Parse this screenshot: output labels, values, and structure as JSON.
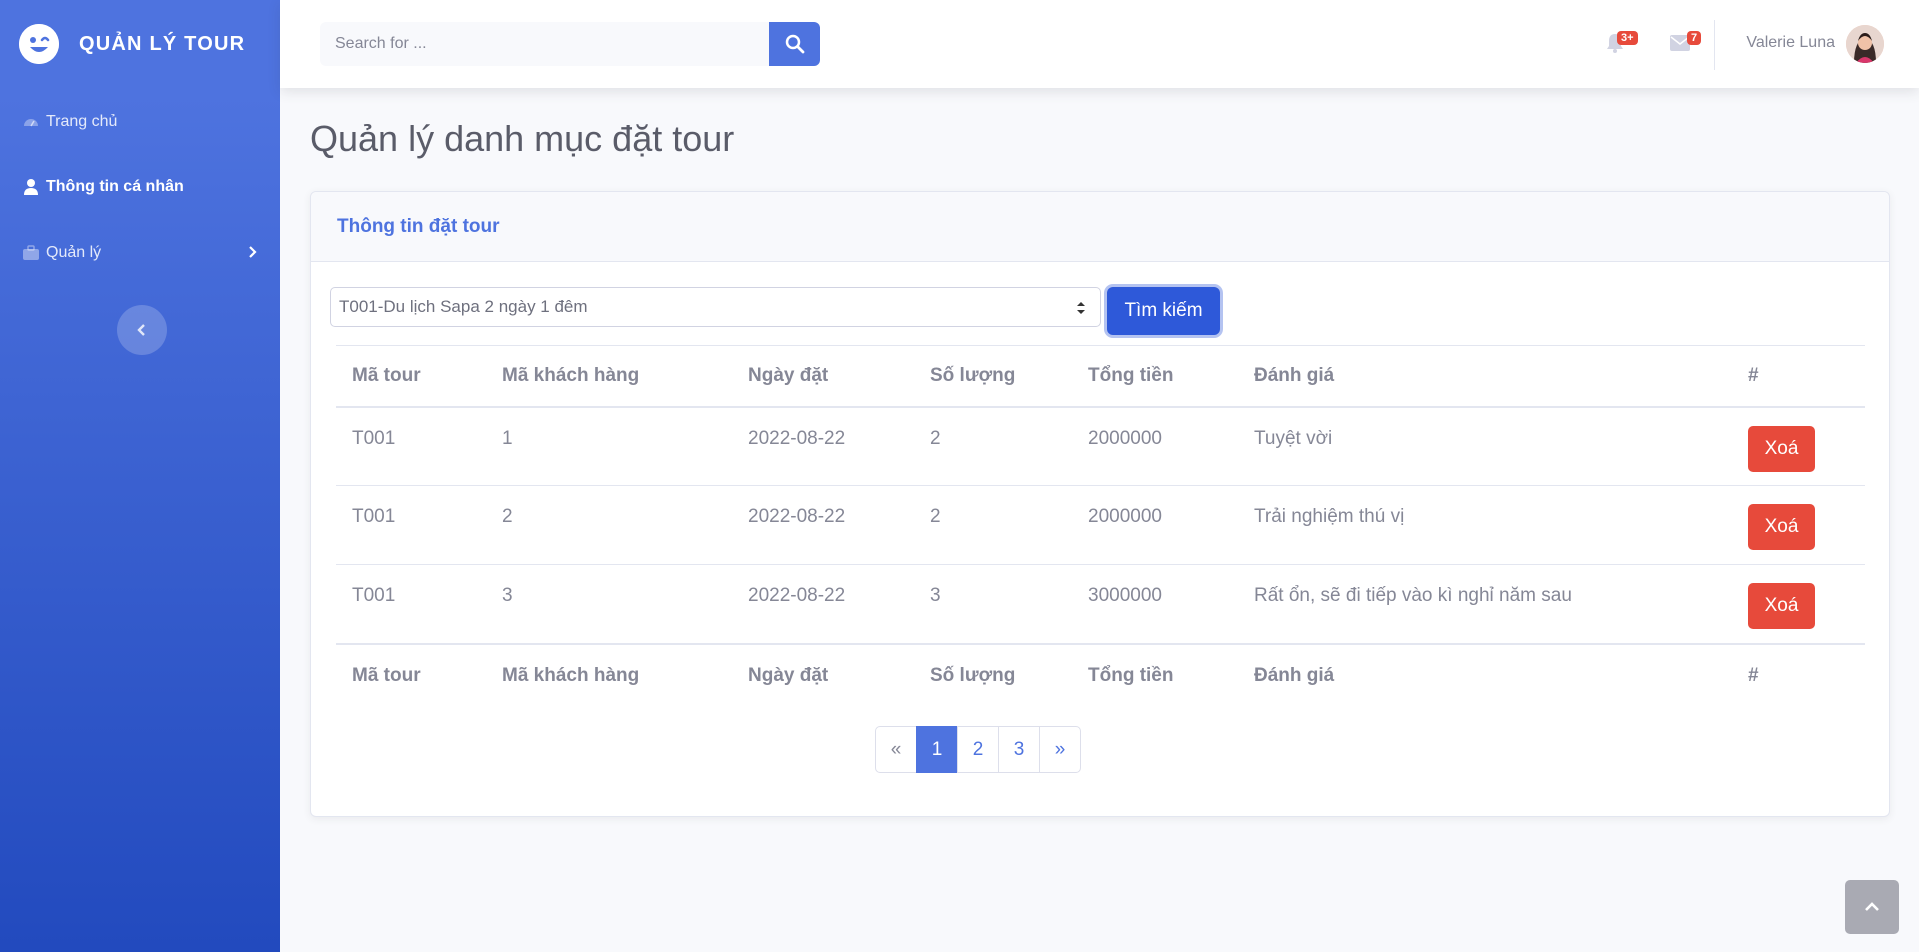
{
  "brand": {
    "name": "QUẢN LÝ TOUR",
    "icon": "laugh-wink-icon"
  },
  "sidebar": {
    "items": [
      {
        "label": "Trang chủ",
        "icon": "tachometer-icon"
      },
      {
        "label": "Thông tin cá nhân",
        "icon": "user-icon"
      },
      {
        "label": "Quản lý",
        "icon": "briefcase-icon"
      }
    ]
  },
  "topbar": {
    "search_placeholder": "Search for ...",
    "alerts_badge": "3+",
    "messages_badge": "7",
    "user_name": "Valerie Luna"
  },
  "page": {
    "title": "Quản lý danh mục đặt tour"
  },
  "card": {
    "title": "Thông tin đặt tour",
    "select_value": "T001-Du lịch Sapa 2 ngày 1 đêm",
    "search_button": "Tìm kiếm"
  },
  "table": {
    "headers": [
      "Mã tour",
      "Mã khách hàng",
      "Ngày đặt",
      "Số lượng",
      "Tổng tiền",
      "Đánh giá",
      "#"
    ],
    "rows": [
      {
        "tour": "T001",
        "customer": "1",
        "date": "2022-08-22",
        "qty": "2",
        "total": "2000000",
        "review": "Tuyệt vời",
        "action": "Xoá"
      },
      {
        "tour": "T001",
        "customer": "2",
        "date": "2022-08-22",
        "qty": "2",
        "total": "2000000",
        "review": "Trải nghiệm thú vị",
        "action": "Xoá"
      },
      {
        "tour": "T001",
        "customer": "3",
        "date": "2022-08-22",
        "qty": "3",
        "total": "3000000",
        "review": "Rất ổn, sẽ đi tiếp vào kì nghỉ năm sau",
        "action": "Xoá"
      }
    ]
  },
  "pagination": {
    "prev": "«",
    "pages": [
      "1",
      "2",
      "3"
    ],
    "next": "»",
    "active": "1"
  },
  "colors": {
    "primary": "#4e73df",
    "danger": "#e74a3b"
  }
}
